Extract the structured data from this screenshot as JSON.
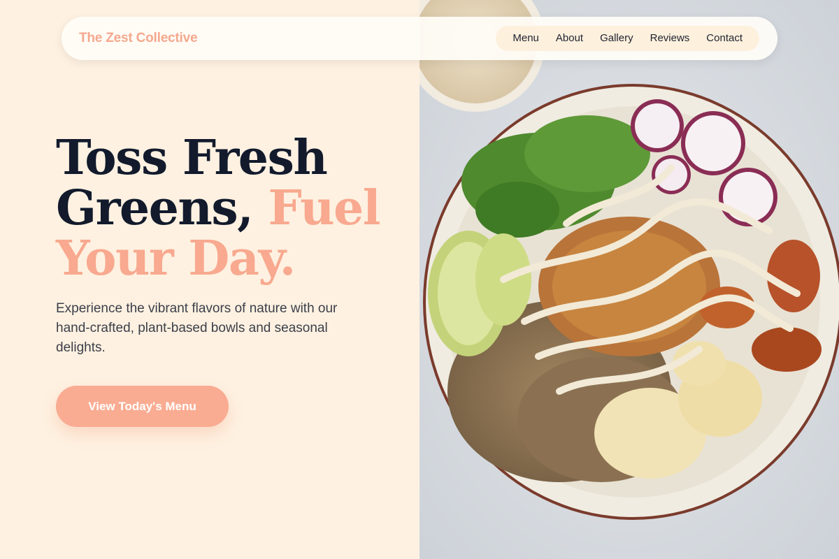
{
  "brand": {
    "name": "The Zest Collective"
  },
  "nav": {
    "links": [
      "Menu",
      "About",
      "Gallery",
      "Reviews",
      "Contact"
    ]
  },
  "hero": {
    "headline_line1": "Toss Fresh",
    "headline_line2_dark": "Greens,",
    "headline_line2_accent": "Fuel",
    "headline_line3_accent": "Your Day.",
    "subtext": "Experience the vibrant flavors of nature with our hand-crafted, plant-based bowls and seasonal delights.",
    "cta_label": "View Today's Menu"
  },
  "colors": {
    "background": "#fef1e1",
    "accent": "#f8a98f",
    "headline_dark": "#121a2c",
    "body_text": "#3b3f4a"
  },
  "image": {
    "subject": "salad-bowl-photo"
  }
}
